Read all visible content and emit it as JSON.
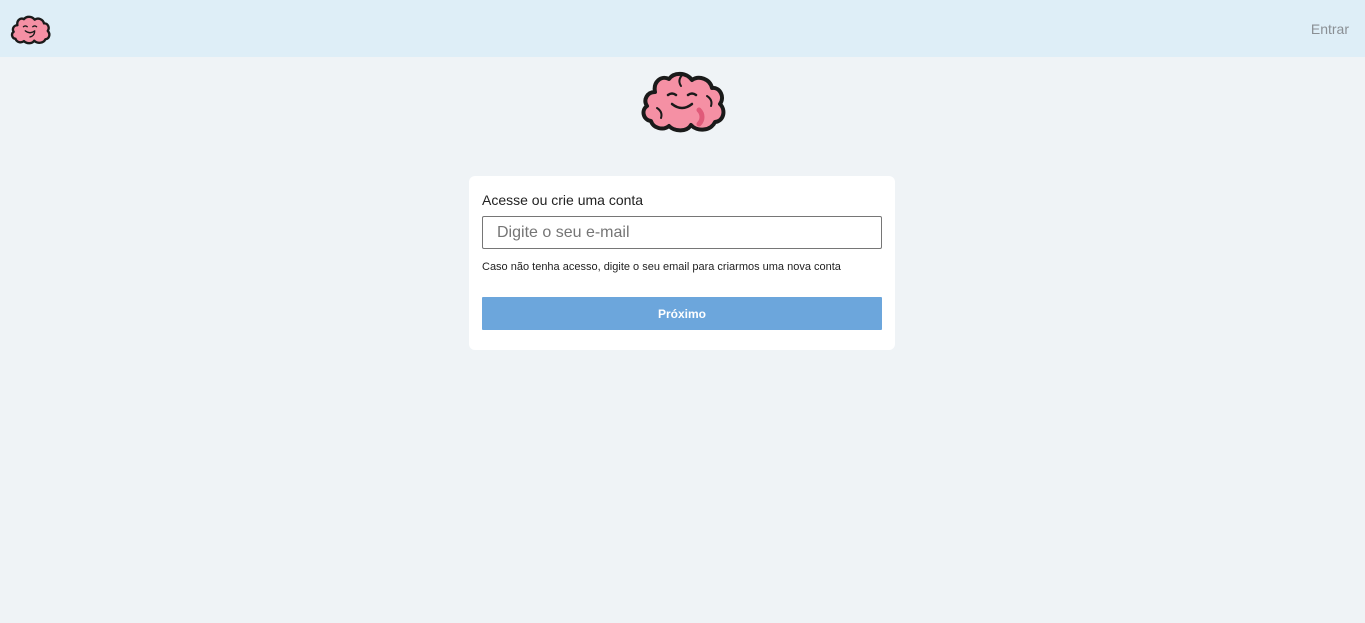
{
  "header": {
    "logo_icon": "brain-icon",
    "signin_label": "Entrar"
  },
  "main": {
    "logo_icon": "brain-icon"
  },
  "card": {
    "title": "Acesse ou crie uma conta",
    "email_placeholder": "Digite o seu e-mail",
    "email_value": "",
    "hint": "Caso não tenha acesso, digite o seu email para criarmos uma nova conta",
    "next_label": "Próximo"
  },
  "colors": {
    "header_bg": "#deeef7",
    "page_bg": "#eff3f6",
    "button_bg": "#6ca6dc",
    "brain_pink": "#f590a4"
  }
}
